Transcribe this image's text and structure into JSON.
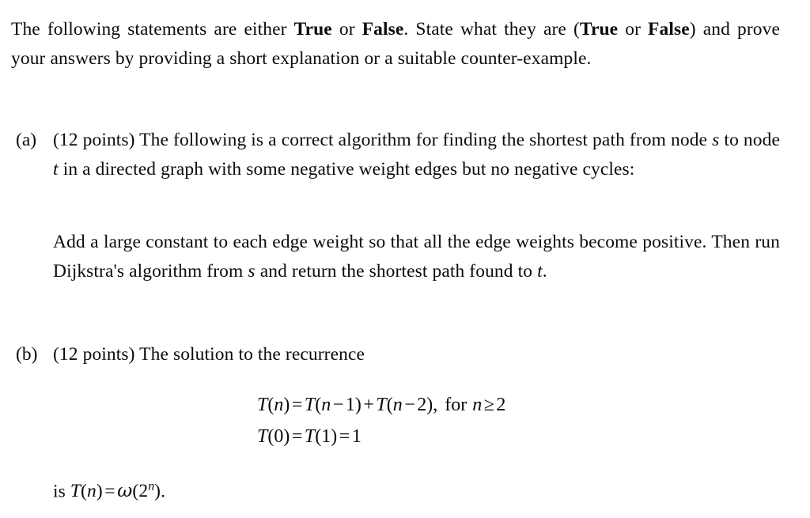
{
  "document": {
    "type": "exam-problem-statement",
    "background_color": "#ffffff",
    "text_color": "#0c0c0c"
  },
  "intro": {
    "segment_1": "The following statements are either ",
    "bold_1": "True",
    "segment_2": " or ",
    "bold_2": "False",
    "segment_3": ". State what they are (",
    "bold_3": "True",
    "segment_4": " or ",
    "bold_4": "False",
    "segment_5": ") and prove your answers by providing a short explanation or a suitable counter-example."
  },
  "items": {
    "a": {
      "label": "(a)",
      "points": "(12 points)",
      "body": " The following is a correct algorithm for finding the shortest path from node ",
      "var_s": "s",
      "body_2": " to node ",
      "var_t": "t",
      "body_3": " in a directed graph with some negative weight edges but no negative cycles:",
      "quote_1": "Add a large constant to each edge weight so that all the edge weights become positive. Then run Dijkstra's algorithm from ",
      "quote_var_s": "s",
      "quote_2": " and return the shortest path found to ",
      "quote_var_t": "t",
      "quote_3": "."
    },
    "b": {
      "label": "(b)",
      "points": "(12 points)",
      "body": " The solution to the recurrence",
      "tail_prefix": "is ",
      "tail_period": "."
    }
  },
  "equations": {
    "line1": {
      "lhs_fn": "T",
      "lhs_open": "(",
      "lhs_var": "n",
      "lhs_close": ")",
      "eq": "=",
      "t1_fn": "T",
      "t1_open": "(",
      "t1_var": "n",
      "t1_minus": "−",
      "t1_num": "1",
      "t1_close": ")",
      "plus": "+",
      "t2_fn": "T",
      "t2_open": "(",
      "t2_var": "n",
      "t2_minus": "−",
      "t2_num": "2",
      "t2_close": ")",
      "comma": ",",
      "for_text": "for",
      "cond_var": "n",
      "cond_rel": "≥",
      "cond_num": "2"
    },
    "line2": {
      "fn1": "T",
      "open1": "(",
      "num1": "0",
      "close1": ")",
      "eq1": "=",
      "fn2": "T",
      "open2": "(",
      "num2": "1",
      "close2": ")",
      "eq2": "=",
      "result": "1"
    },
    "tail": {
      "fn": "T",
      "open": "(",
      "var": "n",
      "close": ")",
      "eq": "=",
      "omega": "ω",
      "bopen": "(",
      "base": "2",
      "exponent": "n",
      "bclose": ")"
    }
  }
}
